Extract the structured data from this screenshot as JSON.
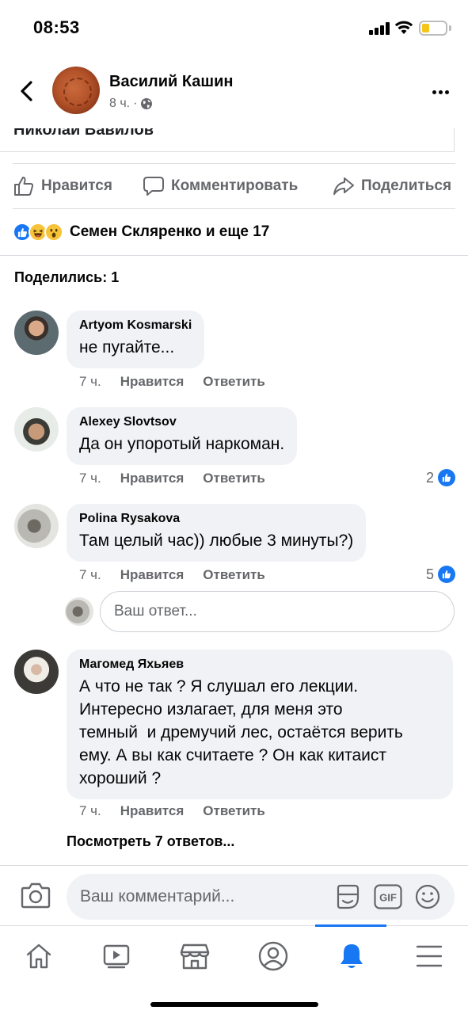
{
  "status_bar": {
    "time": "08:53"
  },
  "header": {
    "author": "Василий Кашин",
    "time": "8 ч.",
    "separator": "·"
  },
  "post": {
    "fragment_text": "Николай Вавилов"
  },
  "actions": {
    "like": "Нравится",
    "comment": "Комментировать",
    "share": "Поделиться"
  },
  "reactions": {
    "summary": "Семен Скляренко и еще 17"
  },
  "shares": {
    "label": "Поделились: 1"
  },
  "comments": [
    {
      "author": "Artyom Kosmarski",
      "text": "не пугайте...",
      "time": "7 ч.",
      "like": "Нравится",
      "reply": "Ответить",
      "likes": ""
    },
    {
      "author": "Alexey Slovtsov",
      "text": "Да он упоротый наркоман.",
      "time": "7 ч.",
      "like": "Нравится",
      "reply": "Ответить",
      "likes": "2"
    },
    {
      "author": "Polina Rysakova",
      "text": "Там целый час)) любые 3 минуты?)",
      "time": "7 ч.",
      "like": "Нравится",
      "reply": "Ответить",
      "likes": "5"
    },
    {
      "author": "Магомед Яхьяев",
      "text_lines": [
        "А что не так ? Я слушал его лекции.",
        "Интересно излагает, для меня это",
        "темный  и дремучий лес, остаётся верить",
        "ему. А вы как считаете ? Он как китаист",
        "хороший ?"
      ],
      "time": "7 ч.",
      "like": "Нравится",
      "reply": "Ответить"
    }
  ],
  "reply_box": {
    "placeholder": "Ваш ответ..."
  },
  "view_replies": "Посмотреть 7 ответов...",
  "composer": {
    "placeholder": "Ваш комментарий...",
    "gif_label": "GIF"
  },
  "colors": {
    "accent": "#1877f2",
    "secondary_text": "#65676b",
    "bubble": "#f0f2f5"
  },
  "bottom_nav": {
    "items": [
      "home-icon",
      "watch-icon",
      "marketplace-icon",
      "profile-icon",
      "notifications-icon",
      "menu-icon"
    ],
    "active": "notifications-icon"
  }
}
